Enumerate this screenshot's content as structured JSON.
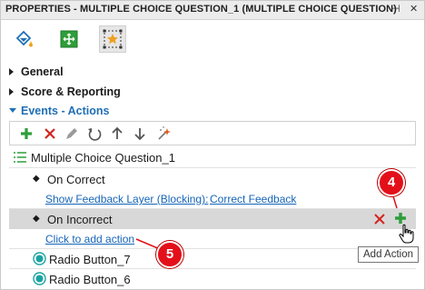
{
  "window": {
    "title": "PROPERTIES - MULTIPLE CHOICE QUESTION_1 (MULTIPLE CHOICE QUESTION)",
    "pin_glyph": "⊣",
    "close_glyph": "✕"
  },
  "property_tabs": [
    {
      "icon": "paint-bucket-icon"
    },
    {
      "icon": "resize-image-icon"
    },
    {
      "icon": "star-selection-icon",
      "selected": true
    }
  ],
  "sections": {
    "general": "General",
    "score": "Score & Reporting",
    "events": "Events - Actions"
  },
  "toolbar": [
    "add-icon",
    "delete-icon",
    "edit-icon",
    "undo-icon",
    "move-up-icon",
    "move-down-icon",
    "magic-wand-icon"
  ],
  "tree": {
    "root": "Multiple Choice Question_1",
    "on_correct": "On Correct",
    "show_feedback": "Show Feedback Layer (Blocking):",
    "correct_feedback": "Correct Feedback",
    "on_incorrect": "On Incorrect",
    "add_action_link": "Click to add action",
    "radio_7": "Radio Button_7",
    "radio_6": "Radio Button_6"
  },
  "annotations": {
    "badge_4": "4",
    "badge_5": "5"
  },
  "tooltip": "Add Action",
  "colors": {
    "accent_blue": "#1f6fb5",
    "link_blue": "#1565b8",
    "add_green": "#2e9e3a",
    "delete_red": "#d4241f",
    "badge_red": "#e3101a",
    "radio_teal": "#1aa3a3"
  }
}
